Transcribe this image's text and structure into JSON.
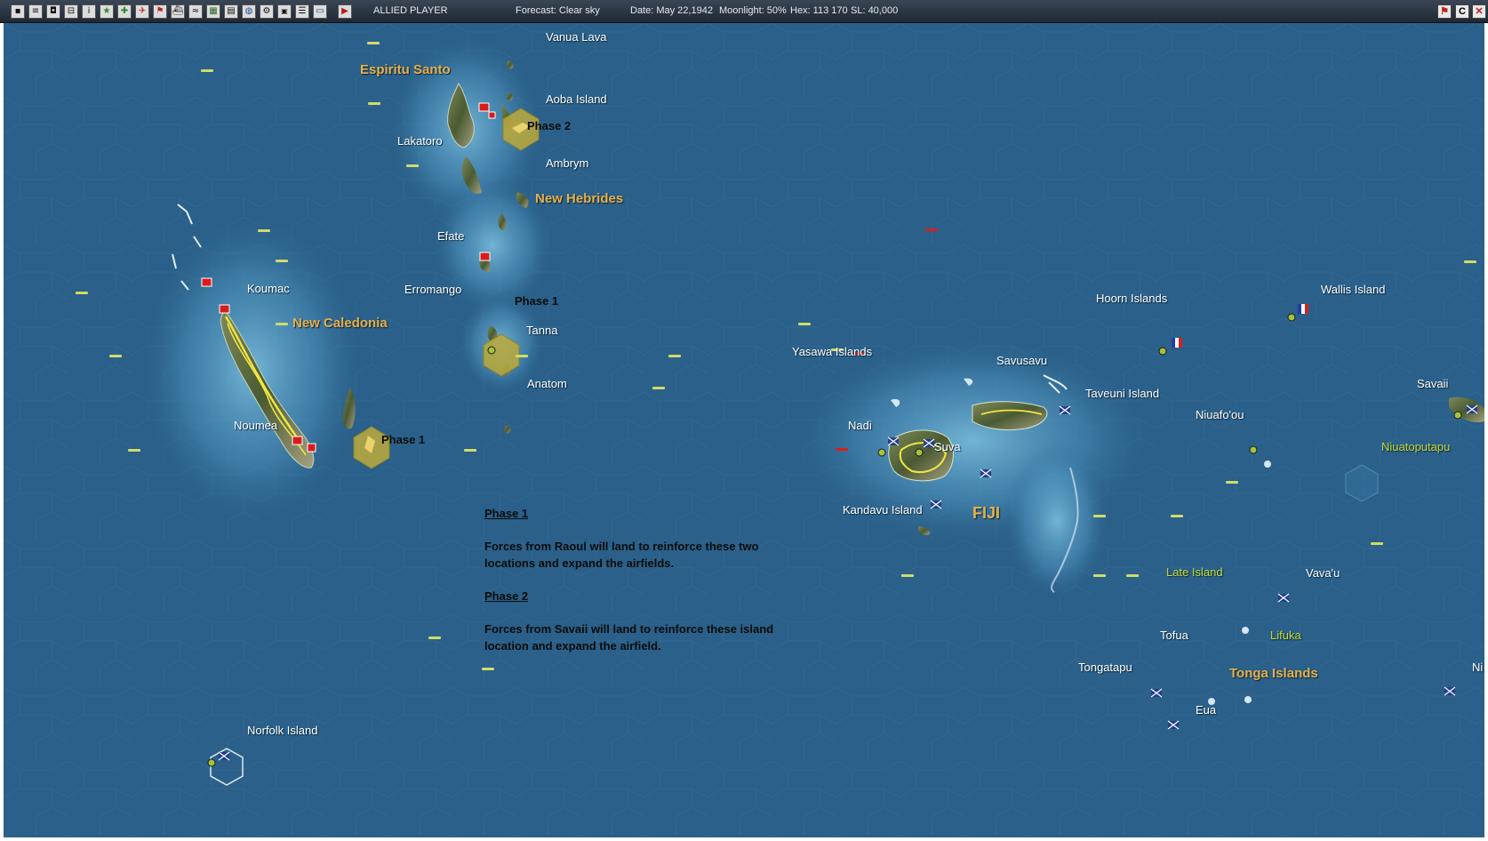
{
  "toolbar": {
    "player": "ALLIED PLAYER",
    "forecast": "Forecast: Clear sky",
    "date": "Date: May 22,1942",
    "moonlight": "Moonlight: 50%",
    "hex": "Hex: 113 170",
    "sl": "SL: 40,000",
    "window_buttons": [
      "C"
    ]
  },
  "map": {
    "labels": {
      "vanua_lava": "Vanua Lava",
      "espiritu_santo": "Espiritu Santo",
      "aoba_island": "Aoba Island",
      "lakatoro": "Lakatoro",
      "ambrym": "Ambrym",
      "new_hebrides": "New Hebrides",
      "efate": "Efate",
      "koumac": "Koumac",
      "erromango": "Erromango",
      "new_caledonia": "New Caledonia",
      "tanna": "Tanna",
      "anatom": "Anatom",
      "noumea": "Noumea",
      "norfolk_island": "Norfolk Island",
      "yasawa_islands": "Yasawa Islands",
      "savusavu": "Savusavu",
      "taveuni_island": "Taveuni Island",
      "nadi": "Nadi",
      "suva": "Suva",
      "kandavu_island": "Kandavu Island",
      "fiji": "FIJI",
      "hoorn_islands": "Hoorn Islands",
      "wallis_island": "Wallis Island",
      "niuafoou": "Niuafo'ou",
      "savaii": "Savaii",
      "niuatoputapu": "Niuatoputapu",
      "late_island": "Late Island",
      "vavau": "Vava'u",
      "tofua": "Tofua",
      "lifuka": "Lifuka",
      "tongatapu": "Tongatapu",
      "tonga_islands": "Tonga Islands",
      "eua": "Eua",
      "ni": "Ni"
    },
    "phase_markers": {
      "aoba": "Phase 2",
      "tanna": "Phase 1",
      "new_caledonia": "Phase 1"
    },
    "colors": {
      "ocean": "#2a6089",
      "region_label": "#e7b04c",
      "green_label": "#c8dc3a",
      "phase_hex": "#b8a83e"
    }
  },
  "notes": {
    "phase1_heading": "Phase 1",
    "phase1_text": "Forces from Raoul will land to reinforce these two locations and expand the airfields.",
    "phase2_heading": "Phase 2",
    "phase2_text": "Forces from Savaii will land to reinforce these island location and expand the airfield."
  }
}
